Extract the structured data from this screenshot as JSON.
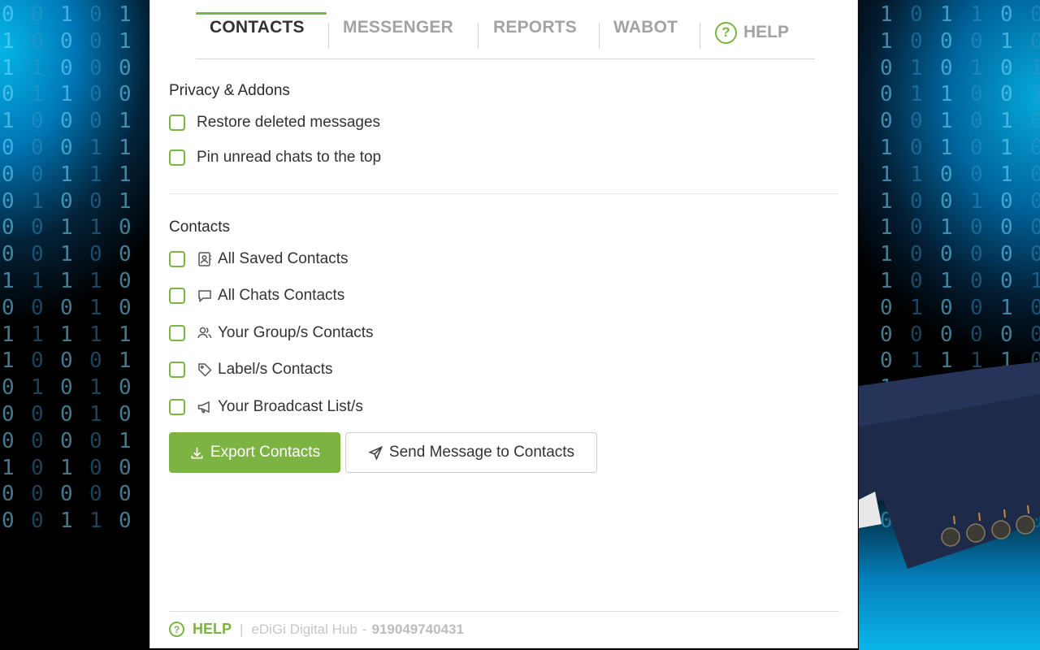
{
  "tabs": [
    {
      "label": "CONTACTS",
      "active": true
    },
    {
      "label": "MESSENGER",
      "active": false
    },
    {
      "label": "REPORTS",
      "active": false
    },
    {
      "label": "WABOT",
      "active": false
    }
  ],
  "help_tab": {
    "glyph": "?",
    "label": "HELP"
  },
  "privacy": {
    "title": "Privacy & Addons",
    "options": [
      {
        "label": "Restore deleted messages",
        "checked": false
      },
      {
        "label": "Pin unread chats to the top",
        "checked": false
      }
    ]
  },
  "contacts": {
    "title": "Contacts",
    "options": [
      {
        "label": "All Saved Contacts",
        "icon": "contact-card-icon",
        "checked": false
      },
      {
        "label": "All Chats Contacts",
        "icon": "chat-bubble-icon",
        "checked": false
      },
      {
        "label": "Your Group/s Contacts",
        "icon": "group-icon",
        "checked": false
      },
      {
        "label": "Label/s Contacts",
        "icon": "tag-icon",
        "checked": false
      },
      {
        "label": "Your Broadcast List/s",
        "icon": "megaphone-icon",
        "checked": false
      }
    ]
  },
  "buttons": {
    "export": "Export Contacts",
    "send": "Send Message to Contacts"
  },
  "footer": {
    "help_glyph": "?",
    "help": "HELP",
    "sep": "|",
    "company": "eDiGi Digital Hub",
    "dash": "-",
    "phone": "919049740431"
  },
  "colors": {
    "accent": "#7cb342",
    "tab_inactive": "#a3a3a3",
    "text": "#333333"
  },
  "background_binary": {
    "left_cols": [
      "01101000001011000100",
      "00110001001010100000",
      "10010010111010000101",
      "00000110101110110001",
      "11001111000011001000"
    ],
    "right_cols": [
      "11000111111000110100",
      "00110010000101100000",
      "10011100101001101101",
      "10100001000001100110",
      "01001110000101111000",
      "00110000001000100000"
    ]
  }
}
